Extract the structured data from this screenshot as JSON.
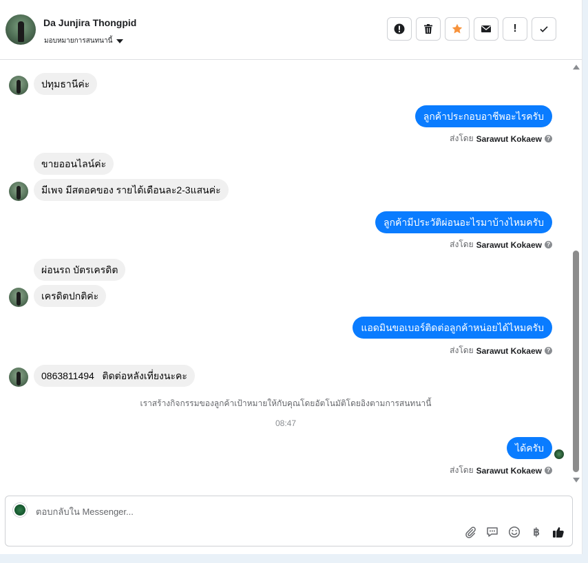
{
  "header": {
    "contact_name": "Da Junjira Thongpid",
    "assign_label": "มอบหมายการสนทนานี้",
    "actions": [
      {
        "icon": "alert-circle-icon"
      },
      {
        "icon": "trash-icon"
      },
      {
        "icon": "star-icon",
        "color": "#f7923b"
      },
      {
        "icon": "mail-icon"
      },
      {
        "icon": "exclamation-icon",
        "label": "!"
      },
      {
        "icon": "checkmark-icon"
      }
    ]
  },
  "messages": {
    "m1": "ปทุมธานีค่ะ",
    "m2": "ลูกค้าประกอบอาชีพอะไรครับ",
    "m3": "ขายออนไลน์ค่ะ",
    "m4": "มีเพจ มีสตอคของ รายได้เดือนละ2-3แสนค่ะ",
    "m5": "ลูกค้ามีประวัติผ่อนอะไรมาบ้างไหมครับ",
    "m6": "ผ่อนรถ บัตรเครดิต",
    "m7": "เครดิตปกติค่ะ",
    "m8": "แอดมินขอเบอร์ติดต่อลูกค้าหน่อยได้ไหมครับ",
    "m9": "0863811494   ติดต่อหลังเที่ยงนะคะ",
    "m10": "ได้ครับ"
  },
  "sent_by": {
    "prefix": "ส่งโดย",
    "agent": "Sarawut Kokaew",
    "help": "?"
  },
  "system_note": "เราสร้างกิจกรรมของลูกค้าเป้าหมายให้กับคุณโดยอัตโนมัติโดยอิงตามการสนทนานี้",
  "timestamp": "08:47",
  "composer": {
    "placeholder": "ตอบกลับใน Messenger...",
    "tools": [
      "attachment-icon",
      "saved-reply-icon",
      "emoji-icon",
      "baht-icon",
      "thumbs-up-icon"
    ],
    "baht_symbol": "฿"
  },
  "colors": {
    "outgoing": "#0a7cff",
    "incoming": "#f0f0f0"
  }
}
